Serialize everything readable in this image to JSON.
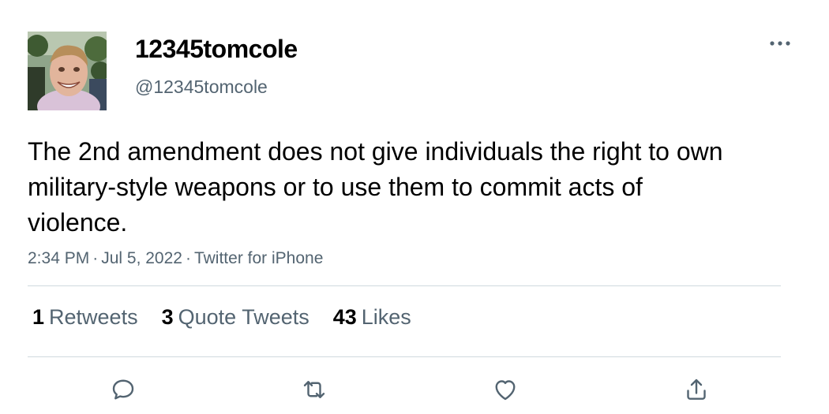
{
  "author": {
    "display_name": "12345tomcole",
    "handle": "@12345tomcole",
    "avatar": "profile-photo"
  },
  "tweet": {
    "text": "The 2nd amendment does not give individuals the right to own military-style weapons or to use them to commit acts of violence.",
    "time": "2:34 PM",
    "date": "Jul 5, 2022",
    "client": "Twitter for iPhone",
    "separator": "·"
  },
  "stats": {
    "retweets_count": "1",
    "retweets_label": "Retweets",
    "quotes_count": "3",
    "quotes_label": "Quote Tweets",
    "likes_count": "43",
    "likes_label": "Likes"
  },
  "actions": [
    "reply-icon",
    "retweet-icon",
    "like-icon",
    "share-icon"
  ],
  "colors": {
    "text_primary": "#000000",
    "text_secondary": "#536471",
    "divider": "#cfd9de",
    "background": "#ffffff"
  }
}
